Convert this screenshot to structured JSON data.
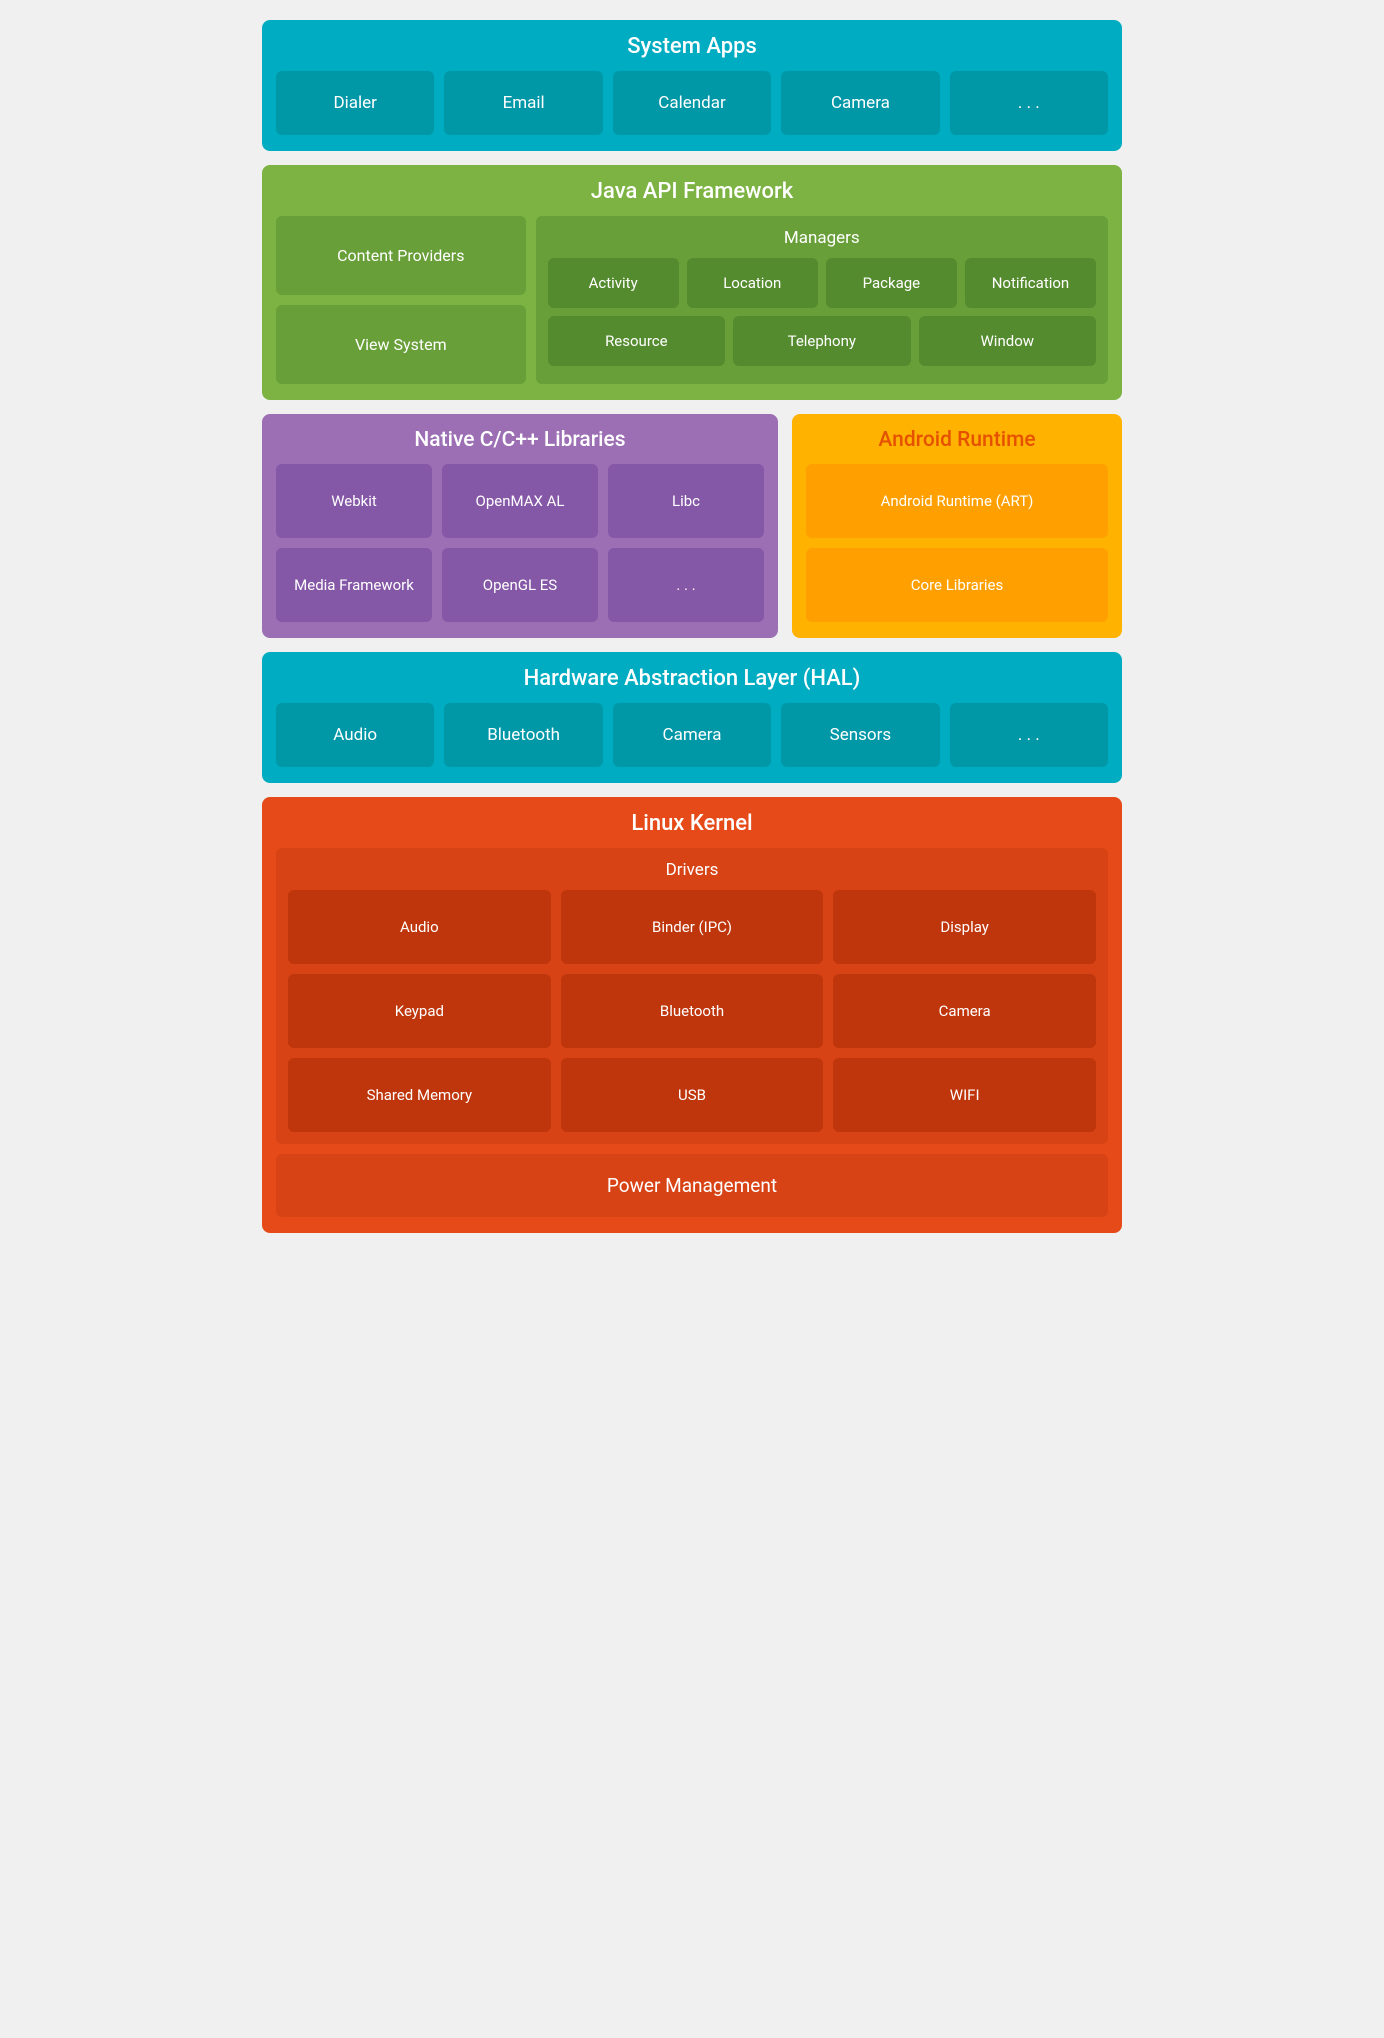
{
  "systemApps": {
    "title": "System Apps",
    "apps": [
      "Dialer",
      "Email",
      "Calendar",
      "Camera",
      ". . ."
    ]
  },
  "javaAPI": {
    "title": "Java API Framework",
    "left": [
      "Content Providers",
      "View System"
    ],
    "managers": {
      "title": "Managers",
      "row1": [
        "Activity",
        "Location",
        "Package",
        "Notification"
      ],
      "row2": [
        "Resource",
        "Telephony",
        "Window"
      ]
    }
  },
  "nativeCpp": {
    "title": "Native C/C++ Libraries",
    "libs": [
      "Webkit",
      "OpenMAX AL",
      "Libc",
      "Media Framework",
      "OpenGL ES",
      ". . ."
    ]
  },
  "androidRuntime": {
    "title": "Android Runtime",
    "items": [
      "Android Runtime (ART)",
      "Core Libraries"
    ]
  },
  "hal": {
    "title": "Hardware Abstraction Layer (HAL)",
    "items": [
      "Audio",
      "Bluetooth",
      "Camera",
      "Sensors",
      ". . ."
    ]
  },
  "linuxKernel": {
    "title": "Linux Kernel",
    "drivers": {
      "title": "Drivers",
      "items": [
        "Audio",
        "Binder (IPC)",
        "Display",
        "Keypad",
        "Bluetooth",
        "Camera",
        "Shared Memory",
        "USB",
        "WIFI"
      ]
    },
    "powerManagement": "Power Management"
  }
}
